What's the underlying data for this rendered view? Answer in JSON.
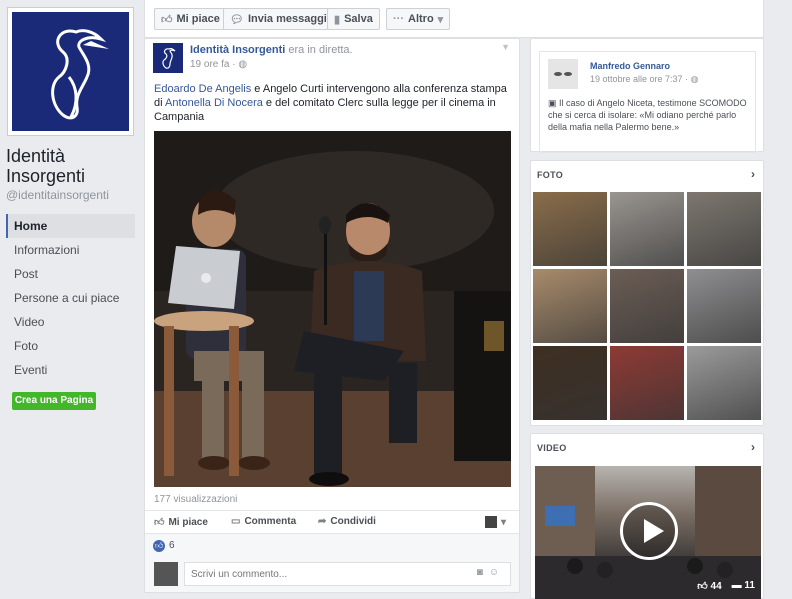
{
  "page": {
    "name": "Identità Insorgenti",
    "handle": "@identitainsorgenti"
  },
  "nav": {
    "items": [
      {
        "label": "Home"
      },
      {
        "label": "Informazioni"
      },
      {
        "label": "Post"
      },
      {
        "label": "Persone a cui piace"
      },
      {
        "label": "Video"
      },
      {
        "label": "Foto"
      },
      {
        "label": "Eventi"
      }
    ],
    "create_page": "Crea una Pagina"
  },
  "action_bar": {
    "like": "Mi piace",
    "message": "Invia messaggio",
    "save": "Salva",
    "more": "Altro"
  },
  "post": {
    "author": "Identità Insorgenti",
    "action": "era in diretta.",
    "time": "19 ore fa ·",
    "text": {
      "p1": "Edoardo De Angelis",
      "p2": " e Angelo Curti intervengono alla conferenza stampa di ",
      "p3": "Antonella Di Nocera",
      "p4": " e del comitato Clerc sulla legge per il cinema in Campania"
    },
    "views": "177 visualizzazioni",
    "actions": {
      "like": "Mi piace",
      "comment": "Commenta",
      "share": "Condividi"
    },
    "likes_count": "6",
    "comment_placeholder": "Scrivi un commento..."
  },
  "side_post": {
    "author": "Manfredo Gennaro",
    "time": "19 ottobre alle ore 7:37 ·",
    "text": "Il caso di Angelo Niceta, testimone SCOMODO che si cerca di isolare: «Mi odiano perché parlo della mafia nella Palermo bene.»"
  },
  "photos": {
    "title": "FOTO",
    "colors": [
      "#8a6d4a",
      "#9a9590",
      "#7d776f",
      "#a88b6b",
      "#6b5d55",
      "#8f8e90",
      "#3e2f22",
      "#8e3a35",
      "#9b9b9b"
    ]
  },
  "video": {
    "title": "VIDEO",
    "likes": "44",
    "comments": "11"
  }
}
